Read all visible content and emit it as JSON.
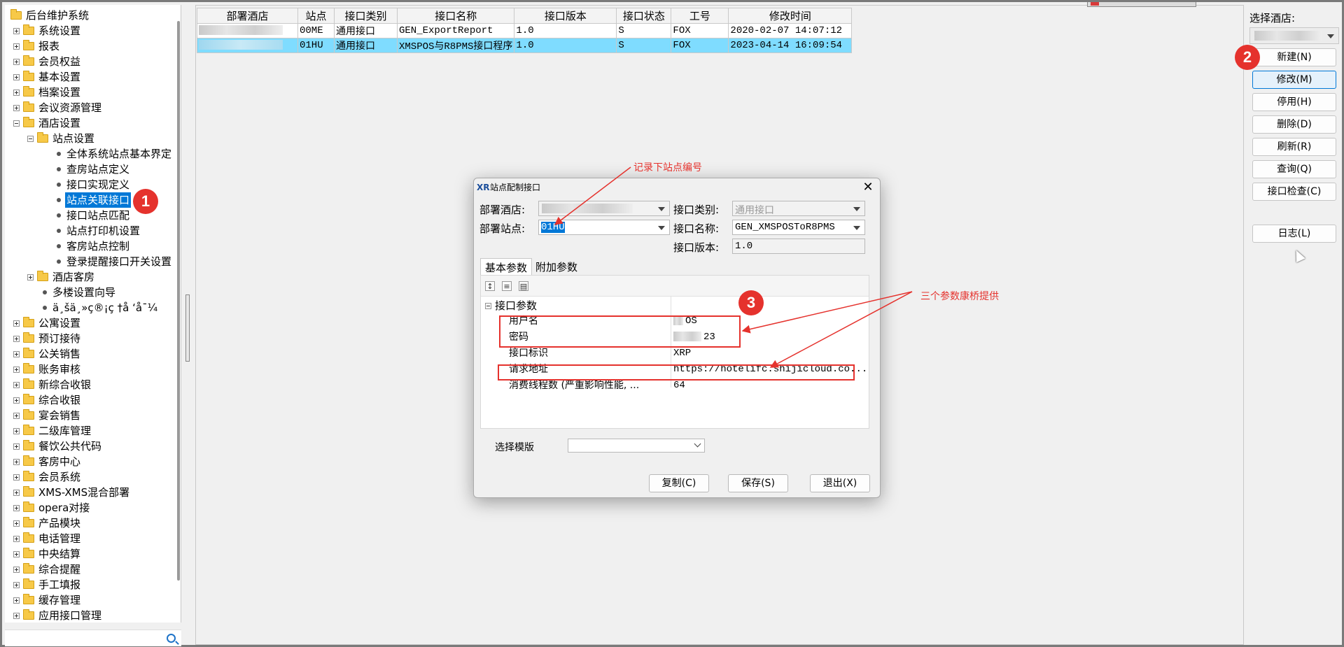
{
  "tree": {
    "items": [
      {
        "label": "后台维护系统",
        "kind": "folder",
        "level": 0,
        "expander": "none"
      },
      {
        "label": "系统设置",
        "kind": "folder",
        "level": 1,
        "expander": "plus"
      },
      {
        "label": "报表",
        "kind": "folder",
        "level": 1,
        "expander": "plus"
      },
      {
        "label": "会员权益",
        "kind": "folder",
        "level": 1,
        "expander": "plus"
      },
      {
        "label": "基本设置",
        "kind": "folder",
        "level": 1,
        "expander": "plus"
      },
      {
        "label": "档案设置",
        "kind": "folder",
        "level": 1,
        "expander": "plus"
      },
      {
        "label": "会议资源管理",
        "kind": "folder",
        "level": 1,
        "expander": "plus"
      },
      {
        "label": "酒店设置",
        "kind": "folder",
        "level": 1,
        "expander": "minus"
      },
      {
        "label": "站点设置",
        "kind": "folder",
        "level": 2,
        "expander": "minus"
      },
      {
        "label": "全体系统站点基本界定",
        "kind": "leaf",
        "level": 3
      },
      {
        "label": "查房站点定义",
        "kind": "leaf",
        "level": 3
      },
      {
        "label": "接口实现定义",
        "kind": "leaf",
        "level": 3
      },
      {
        "label": "站点关联接口",
        "kind": "leaf",
        "level": 3,
        "selected": true
      },
      {
        "label": "接口站点匹配",
        "kind": "leaf",
        "level": 3
      },
      {
        "label": "站点打印机设置",
        "kind": "leaf",
        "level": 3
      },
      {
        "label": "客房站点控制",
        "kind": "leaf",
        "level": 3
      },
      {
        "label": "登录提醒接口开关设置",
        "kind": "leaf",
        "level": 3
      },
      {
        "label": "酒店客房",
        "kind": "folder",
        "level": 2,
        "expander": "plus"
      },
      {
        "label": "多楼设置向导",
        "kind": "leaf",
        "level": 2
      },
      {
        "label": "ä¸šä¸»ç®¡ç †å   ‘å¯¼",
        "kind": "leaf",
        "level": 2
      },
      {
        "label": "公寓设置",
        "kind": "folder",
        "level": 1,
        "expander": "plus"
      },
      {
        "label": "预订接待",
        "kind": "folder",
        "level": 1,
        "expander": "plus"
      },
      {
        "label": "公关销售",
        "kind": "folder",
        "level": 1,
        "expander": "plus"
      },
      {
        "label": "账务审核",
        "kind": "folder",
        "level": 1,
        "expander": "plus"
      },
      {
        "label": "新综合收银",
        "kind": "folder",
        "level": 1,
        "expander": "plus"
      },
      {
        "label": "综合收银",
        "kind": "folder",
        "level": 1,
        "expander": "plus"
      },
      {
        "label": "宴会销售",
        "kind": "folder",
        "level": 1,
        "expander": "plus"
      },
      {
        "label": "二级库管理",
        "kind": "folder",
        "level": 1,
        "expander": "plus"
      },
      {
        "label": "餐饮公共代码",
        "kind": "folder",
        "level": 1,
        "expander": "plus"
      },
      {
        "label": "客房中心",
        "kind": "folder",
        "level": 1,
        "expander": "plus"
      },
      {
        "label": "会员系统",
        "kind": "folder",
        "level": 1,
        "expander": "plus"
      },
      {
        "label": "XMS-XMS混合部署",
        "kind": "folder",
        "level": 1,
        "expander": "plus"
      },
      {
        "label": "opera对接",
        "kind": "folder",
        "level": 1,
        "expander": "plus"
      },
      {
        "label": "产品模块",
        "kind": "folder",
        "level": 1,
        "expander": "plus"
      },
      {
        "label": "电话管理",
        "kind": "folder",
        "level": 1,
        "expander": "plus"
      },
      {
        "label": "中央结算",
        "kind": "folder",
        "level": 1,
        "expander": "plus"
      },
      {
        "label": "综合提醒",
        "kind": "folder",
        "level": 1,
        "expander": "plus"
      },
      {
        "label": "手工填报",
        "kind": "folder",
        "level": 1,
        "expander": "plus"
      },
      {
        "label": "缓存管理",
        "kind": "folder",
        "level": 1,
        "expander": "plus"
      },
      {
        "label": "应用接口管理",
        "kind": "folder",
        "level": 1,
        "expander": "plus"
      }
    ]
  },
  "grid": {
    "headers": [
      "部署酒店",
      "站点",
      "接口类别",
      "接口名称",
      "接口版本",
      "接口状态",
      "工号",
      "修改时间"
    ],
    "rows": [
      {
        "hotel": "",
        "station": "00ME",
        "category": "通用接口",
        "name": "GEN_ExportReport",
        "version": "1.0",
        "status": "S",
        "operator": "FOX",
        "modified": "2020-02-07 14:07:12",
        "selected": false
      },
      {
        "hotel": "",
        "station": "01HU",
        "category": "通用接口",
        "name": "XMSPOS与R8PMS接口程序",
        "version": "1.0",
        "status": "S",
        "operator": "FOX",
        "modified": "2023-04-14 16:09:54",
        "selected": true
      }
    ]
  },
  "right_panel": {
    "hotel_label": "选择酒店:",
    "buttons": [
      {
        "label": "新建(N)",
        "name": "new-button"
      },
      {
        "label": "修改(M)",
        "name": "modify-button",
        "focused": true
      },
      {
        "label": "停用(H)",
        "name": "disable-button"
      },
      {
        "label": "删除(D)",
        "name": "delete-button"
      },
      {
        "label": "刷新(R)",
        "name": "refresh-button"
      },
      {
        "label": "查询(Q)",
        "name": "query-button"
      },
      {
        "label": "接口检查(C)",
        "name": "interface-check-button"
      },
      {
        "label": "日志(L)",
        "name": "log-button"
      }
    ]
  },
  "dialog": {
    "title": "站点配制接口",
    "close_symbol": "✕",
    "logo": "XR",
    "hotel_label": "部署酒店:",
    "station_label": "部署站点:",
    "station_value": "01HU",
    "category_label": "接口类别:",
    "category_value": "通用接口",
    "name_label": "接口名称:",
    "name_value": "GEN_XMSPOSToR8PMS",
    "version_label": "接口版本:",
    "version_value": "1.0",
    "tabs": [
      "基本参数",
      "附加参数"
    ],
    "prop_group": "接口参数",
    "params": [
      {
        "name": "用户名",
        "value": "OS"
      },
      {
        "name": "密码",
        "value": "23"
      },
      {
        "name": "接口标识",
        "value": "XRP"
      },
      {
        "name": "请求地址",
        "value": "https://hotelifc.shijicloud.co..."
      },
      {
        "name": "消费线程数 (严重影响性能, ...",
        "value": "64"
      }
    ],
    "template_label": "选择模版",
    "buttons": [
      "复制(C)",
      "保存(S)",
      "退出(X)"
    ]
  },
  "annotations": {
    "badges": [
      "1",
      "2",
      "3"
    ],
    "note_station": "记录下站点编号",
    "note_params": "三个参数康桥提供"
  },
  "colors": {
    "accent": "#0078d7",
    "selection": "#7fdcff",
    "annotation": "#e5322d"
  }
}
